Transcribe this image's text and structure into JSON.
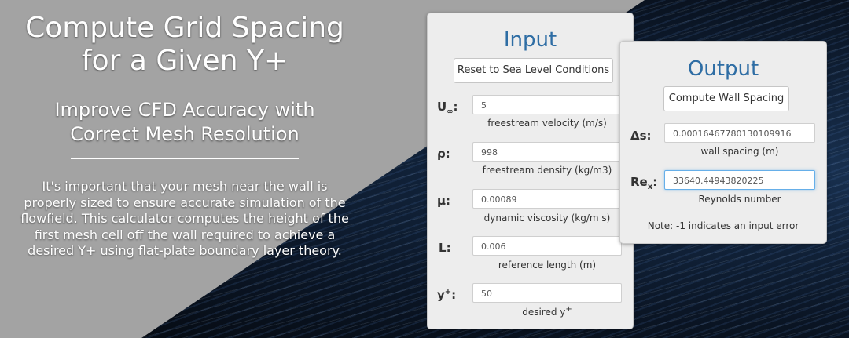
{
  "hero": {
    "title_line1": "Compute Grid Spacing",
    "title_line2": "for a Given Y+",
    "subtitle_line1": "Improve CFD Accuracy with",
    "subtitle_line2": "Correct Mesh Resolution",
    "description": "It's important that your mesh near the wall is properly sized to ensure accurate simulation of the flowfield. This calculator computes the height of the first mesh cell off the wall required to achieve a desired Y+ using flat-plate boundary layer theory."
  },
  "input": {
    "heading": "Input",
    "reset_label": "Reset to Sea Level Conditions",
    "fields": [
      {
        "symbol": "U",
        "symbol_sub": "∞",
        "value": "5",
        "help": "freestream velocity (m/s)"
      },
      {
        "symbol": "ρ",
        "value": "998",
        "help": "freestream density (kg/m3)"
      },
      {
        "symbol": "μ",
        "value": "0.00089",
        "help": "dynamic viscosity (kg/m s)"
      },
      {
        "symbol": "L",
        "value": "0.006",
        "help": "reference length (m)"
      },
      {
        "symbol": "y",
        "symbol_sup": "+",
        "value": "50",
        "help": "desired y",
        "help_sup": "+"
      }
    ]
  },
  "output": {
    "heading": "Output",
    "compute_label": "Compute Wall Spacing",
    "fields": [
      {
        "symbol": "Δs",
        "value": "0.00016467780130109916",
        "help": "wall spacing (m)"
      },
      {
        "symbol": "Re",
        "symbol_sub": "x",
        "value": "33640.44943820225",
        "help": "Reynolds number"
      }
    ],
    "note": "Note: -1 indicates an input error"
  },
  "colors": {
    "accent": "#2e6da4",
    "focus": "#66afe9",
    "background": "#a3a3a3"
  }
}
